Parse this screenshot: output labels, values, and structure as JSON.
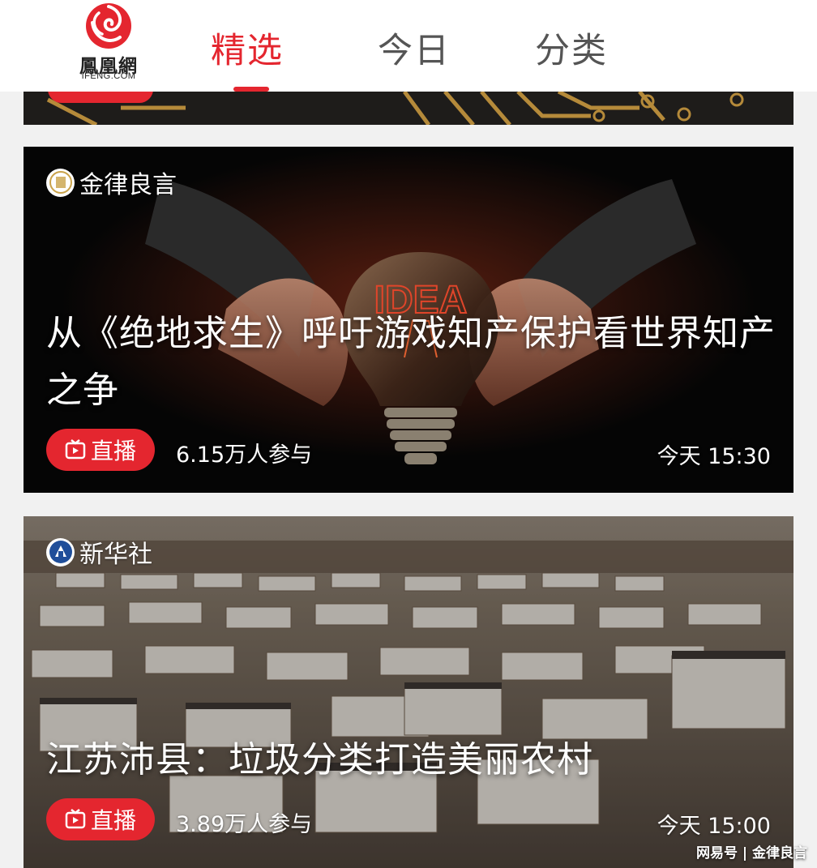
{
  "header": {
    "logo_cn": "鳳凰網",
    "logo_en": "IFENG.COM",
    "tabs": [
      {
        "label": "精选",
        "active": true
      },
      {
        "label": "今日",
        "active": false
      },
      {
        "label": "分类",
        "active": false
      }
    ],
    "accent": "#e4262f"
  },
  "cards": [
    {
      "source": "金律良言",
      "source_icon": "jinlv-avatar-icon",
      "bulb_text": "IDEA",
      "title": "从《绝地求生》呼吁游戏知产保护看世界知产之争",
      "live_label": "直播",
      "participants": "6.15万人参与",
      "time": "今天 15:30"
    },
    {
      "source": "新华社",
      "source_icon": "xinhua-avatar-icon",
      "title": "江苏沛县：垃圾分类打造美丽农村",
      "live_label": "直播",
      "participants": "3.89万人参与",
      "time": "今天 15:00"
    }
  ],
  "watermark": "网易号 | 金律良言"
}
